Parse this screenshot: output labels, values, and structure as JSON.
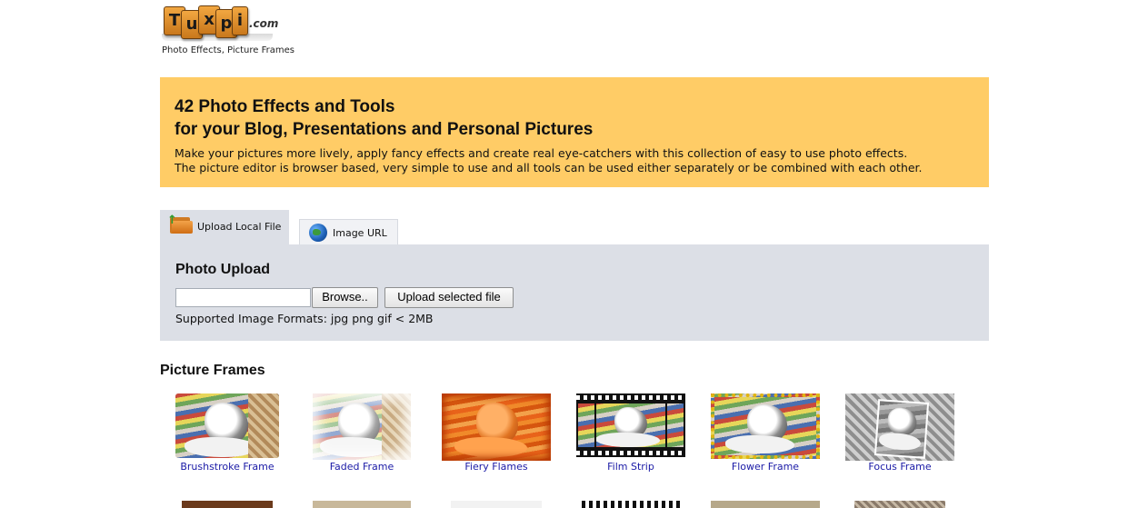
{
  "brand": {
    "logo_letters": [
      "T",
      "u",
      "x",
      "p",
      "i"
    ],
    "logo_suffix": ".com",
    "tagline": "Photo Effects, Picture Frames"
  },
  "banner": {
    "title_line1": "42 Photo Effects and Tools",
    "title_line2": "for your Blog, Presentations and Personal Pictures",
    "text_line1": "Make your pictures more lively, apply fancy effects and create real eye-catchers with this collection of easy to use photo effects.",
    "text_line2": "The picture editor is browser based, very simple to use and all tools can be used either separately or be combined with each other.",
    "bg_color": "#ffcc66"
  },
  "tabs": {
    "local_label": "Upload Local File",
    "url_label": "Image URL"
  },
  "upload": {
    "heading": "Photo Upload",
    "file_value": "",
    "browse_label": "Browse..",
    "upload_label": "Upload selected file",
    "formats": "Supported Image Formats: jpg png gif < 2MB"
  },
  "frames": {
    "heading": "Picture Frames",
    "items": [
      {
        "label": "Brushstroke Frame",
        "icon": "brushstroke-frame-thumbnail"
      },
      {
        "label": "Faded Frame",
        "icon": "faded-frame-thumbnail"
      },
      {
        "label": "Fiery Flames",
        "icon": "fiery-flames-thumbnail"
      },
      {
        "label": "Film Strip",
        "icon": "film-strip-thumbnail"
      },
      {
        "label": "Flower Frame",
        "icon": "flower-frame-thumbnail"
      },
      {
        "label": "Focus Frame",
        "icon": "focus-frame-thumbnail"
      }
    ]
  },
  "colors": {
    "panel": "#dcdfe6",
    "link": "#1a1aa6"
  }
}
